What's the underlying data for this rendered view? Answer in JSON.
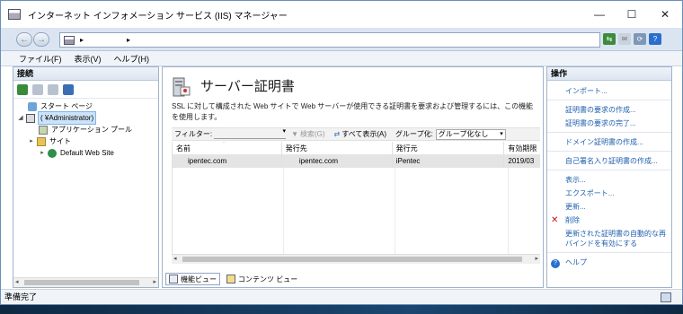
{
  "window": {
    "title": "インターネット インフォメーション サービス (IIS) マネージャー",
    "minimize": "—",
    "maximize": "☐",
    "close": "✕"
  },
  "address": {
    "back": "←",
    "forward": "→",
    "crumb1": "▸",
    "crumb2": "▸"
  },
  "menu": {
    "file": "ファイル(F)",
    "view": "表示(V)",
    "help": "ヘルプ(H)"
  },
  "connections": {
    "header": "接続",
    "tree": [
      {
        "label": "スタート ページ",
        "icon": "start-page-icon"
      },
      {
        "label": "(                    ¥Administrator)",
        "icon": "server-icon"
      },
      {
        "label": "アプリケーション プール",
        "icon": "app-pool-icon"
      },
      {
        "label": "サイト",
        "icon": "sites-folder-icon"
      },
      {
        "label": "Default Web Site",
        "icon": "globe-icon"
      }
    ],
    "expanders": [
      "◢",
      "▸",
      "▸"
    ]
  },
  "feature": {
    "title": "サーバー証明書",
    "description": "SSL に対して構成された Web サイトで Web サーバーが使用できる証明書を要求および管理するには、この機能を使用します。",
    "filter_label": "フィルター:",
    "search_btn": "検索(G)",
    "show_all_btn": "すべて表示(A)",
    "group_label": "グループ化:",
    "group_value": "グループ化なし",
    "columns": [
      "名前",
      "発行先",
      "発行元",
      "有効期限"
    ],
    "rows": [
      {
        "name": "ipentec.com",
        "issued_to": "ipentec.com",
        "issued_by": "iPentec",
        "expires": "2019/03"
      }
    ],
    "sort_indicator": "^",
    "scroll_left": "◂",
    "scroll_right": "▸"
  },
  "view_tabs": {
    "features": "機能ビュー",
    "content": "コンテンツ ビュー"
  },
  "actions": {
    "header": "操作",
    "items": [
      "インポート...",
      "証明書の要求の作成...",
      "証明書の要求の完了...",
      "ドメイン証明書の作成...",
      "自己署名入り証明書の作成...",
      "表示...",
      "エクスポート...",
      "更新...",
      "削除",
      "更新された証明書の自動的な再バインドを有効にする",
      "ヘルプ"
    ]
  },
  "status": {
    "text": "準備完了"
  },
  "colors": {
    "accent_link": "#1f5fad",
    "selection": "#cde3f8",
    "pane_border": "#9fb3cc",
    "delete": "#cc1111"
  }
}
